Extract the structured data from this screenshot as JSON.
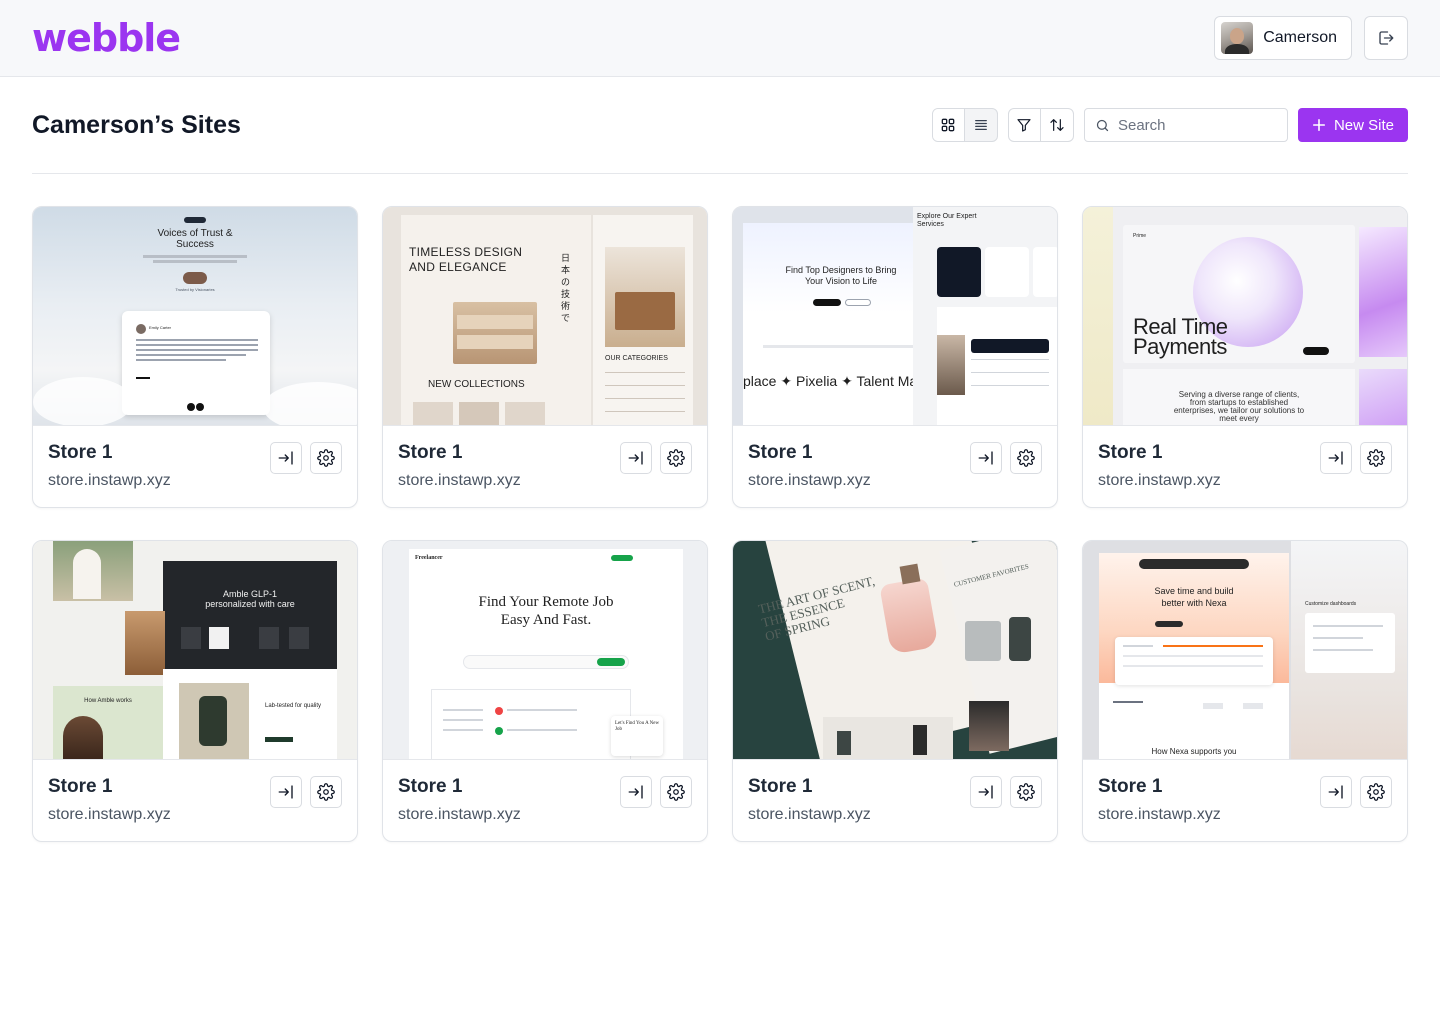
{
  "header": {
    "logo": "webble",
    "user_name": "Camerson"
  },
  "page": {
    "title": "Camerson’s Sites",
    "search_placeholder": "Search",
    "new_site_label": "New Site"
  },
  "sites": [
    {
      "name": "Store 1",
      "url": "store.instawp.xyz",
      "preview": {
        "t1": "Voices of Trust &",
        "t2": "Success",
        "t3": "Trusted by Visionaries",
        "t4": "Emily Carter"
      }
    },
    {
      "name": "Store 1",
      "url": "store.instawp.xyz",
      "preview": {
        "t1": "TIMELESS DESIGN",
        "t2": "AND ELEGANCE",
        "t3": "NEW COLLECTIONS",
        "t4": "OUR CATEGORIES"
      }
    },
    {
      "name": "Store 1",
      "url": "store.instawp.xyz",
      "preview": {
        "t1": "Find Top  Designers to Bring",
        "t2": "Your Vision to Life",
        "t3": "place ✦ Pixelia ✦ Talent Market",
        "t4": "Explore  Our Expert Services"
      }
    },
    {
      "name": "Store 1",
      "url": "store.instawp.xyz",
      "preview": {
        "t1": "Real Time",
        "t2": "Payments",
        "t3": "Serving a diverse range of clients, from startups to established enterprises, we tailor our solutions to meet every",
        "t4": "Prime"
      }
    },
    {
      "name": "Store 1",
      "url": "store.instawp.xyz",
      "preview": {
        "t1": "Amble GLP-1",
        "t2": "personalized with care",
        "t3": "How Amble works",
        "t4": "Lab-tested for quality"
      }
    },
    {
      "name": "Store 1",
      "url": "store.instawp.xyz",
      "preview": {
        "t1": "Find Your Remote Job",
        "t2": "Easy And Fast.",
        "t3": "Freelancer",
        "t4": "Let's Find You A New Job"
      }
    },
    {
      "name": "Store 1",
      "url": "store.instawp.xyz",
      "preview": {
        "t1": "THE ART OF SCENT,",
        "t2": "THE ESSENCE",
        "t3": "OF SPRING",
        "t4": "CUSTOMER FAVORITES"
      }
    },
    {
      "name": "Store 1",
      "url": "store.instawp.xyz",
      "preview": {
        "t1": "Save time and build",
        "t2": "better with Nexa",
        "t3": "How Nexa supports you",
        "t4": "Customize dashboards"
      }
    }
  ],
  "colors": {
    "brand": "#9b35f0",
    "background": "#ffffff",
    "header_bg": "#f7f8fa",
    "border": "#d9dce1"
  },
  "icons": {
    "logout": "logout-icon",
    "grid_view": "grid-view-icon",
    "list_view": "list-view-icon",
    "filter": "filter-icon",
    "sort": "sort-icon",
    "search": "search-icon",
    "plus": "plus-icon",
    "open_site": "login-arrow-icon",
    "settings": "gear-icon"
  }
}
